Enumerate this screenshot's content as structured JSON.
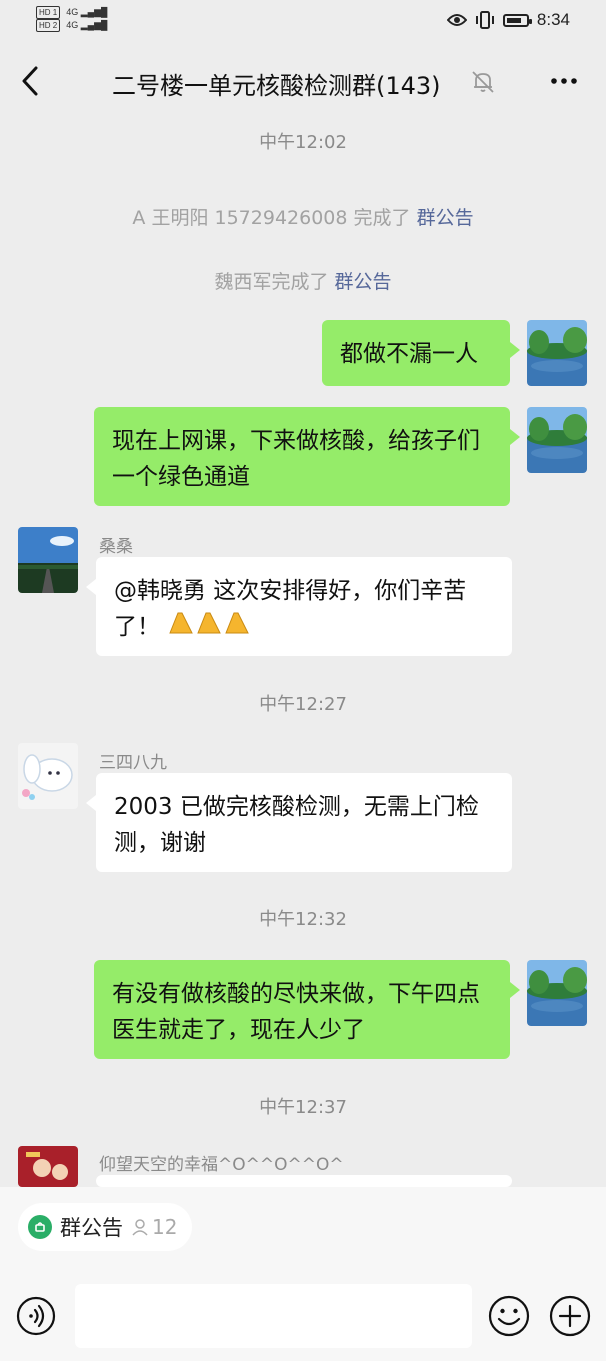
{
  "status_bar": {
    "left_badges": [
      "HD 1",
      "HD 2"
    ],
    "network": [
      "4G",
      "4G"
    ],
    "time": "8:34"
  },
  "header": {
    "title": "二号楼一单元核酸检测群(143)",
    "icons": [
      "back-arrow-icon",
      "mute-bell-icon",
      "more-dots-icon"
    ]
  },
  "messages": {
    "time1": "中午12:02",
    "sys1_text": "A 王明阳 15729426008 完成了 ",
    "sys1_link": "群公告",
    "sys2_text": "魏西军完成了 ",
    "sys2_link": "群公告",
    "m1": "都做不漏一人",
    "m2": "现在上网课，下来做核酸，给孩子们一个绿色通道",
    "m3_sender": "桑桑",
    "m3": "@韩晓勇  这次安排得好，你们辛苦了！",
    "time2": "中午12:27",
    "m4_sender": "三四八九",
    "m4": "2003 已做完核酸检测，无需上门检测，谢谢",
    "time3": "中午12:32",
    "m5": "有没有做核酸的尽快来做，下午四点医生就走了，现在人少了",
    "time4": "中午12:37",
    "m6_sender": "仰望天空的幸福^O^^O^^O^"
  },
  "bottom": {
    "notice_label": "群公告",
    "notice_count": "12",
    "icons": [
      "voice-icon",
      "emoji-icon",
      "plus-icon"
    ]
  },
  "colors": {
    "background": "#ededed",
    "my_bubble": "#95ec69",
    "link": "#56689a",
    "notice_icon": "#2aae67"
  }
}
